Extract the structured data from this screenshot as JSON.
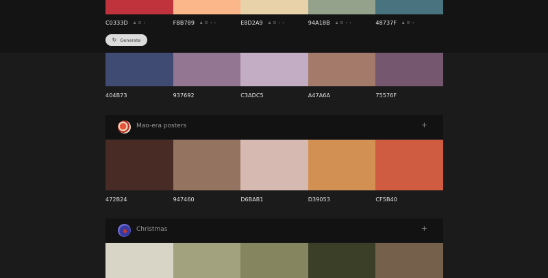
{
  "top_generator": {
    "swatches": [
      {
        "hex": "C0333D",
        "color": "#C0333D"
      },
      {
        "hex": "FBB789",
        "color": "#FBB789"
      },
      {
        "hex": "E8D2A9",
        "color": "#E8D2A9"
      },
      {
        "hex": "94A18B",
        "color": "#94A18B"
      },
      {
        "hex": "48737F",
        "color": "#48737F"
      }
    ],
    "generate_label": "Generate"
  },
  "palettes": [
    {
      "title": "",
      "swatches": [
        {
          "hex": "404B73",
          "color": "#404B73"
        },
        {
          "hex": "937692",
          "color": "#937692"
        },
        {
          "hex": "C3ADC5",
          "color": "#C3ADC5"
        },
        {
          "hex": "A47A6A",
          "color": "#A47A6A"
        },
        {
          "hex": "75576F",
          "color": "#75576F"
        }
      ]
    },
    {
      "title": "Mao-era posters",
      "swatches": [
        {
          "hex": "472B24",
          "color": "#472B24"
        },
        {
          "hex": "947460",
          "color": "#947460"
        },
        {
          "hex": "D6BAB1",
          "color": "#D6BAB1"
        },
        {
          "hex": "D39053",
          "color": "#D39053"
        },
        {
          "hex": "CF5B40",
          "color": "#CF5B40"
        }
      ]
    },
    {
      "title": "Christmas",
      "swatches": [
        {
          "hex": "",
          "color": "#D8D5C7"
        },
        {
          "hex": "",
          "color": "#A3A27F"
        },
        {
          "hex": "",
          "color": "#85855F"
        },
        {
          "hex": "",
          "color": "#3C3F27"
        },
        {
          "hex": "",
          "color": "#74604B"
        }
      ]
    }
  ],
  "icons": {
    "lock": "lock-icon",
    "list": "list-icon",
    "left": "chevron-left-icon",
    "right": "chevron-right-icon",
    "refresh": "refresh-icon",
    "add": "plus-icon"
  }
}
